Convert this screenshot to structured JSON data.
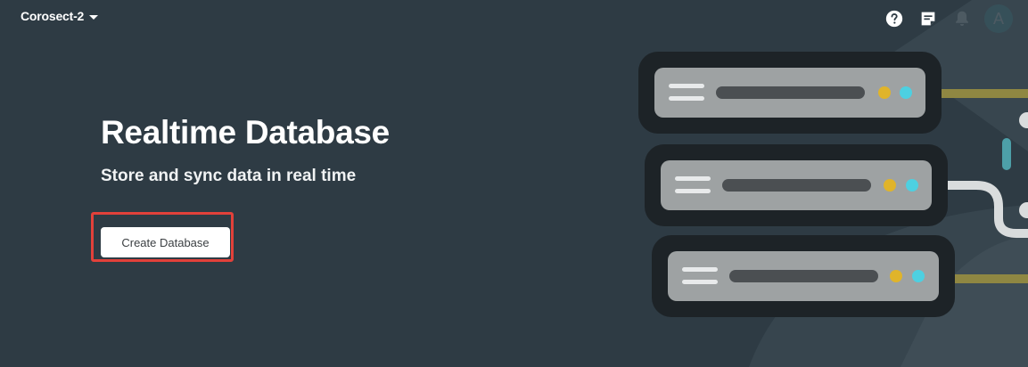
{
  "header": {
    "project_name": "Corosect-2",
    "avatar_initial": "A"
  },
  "icons": {
    "dropdown": "chevron-down-icon",
    "help": "help-icon",
    "notes": "release-notes-icon",
    "notifications": "bell-icon"
  },
  "hero": {
    "title": "Realtime Database",
    "subtitle": "Store and sync data in real time",
    "cta_label": "Create Database"
  },
  "colors": {
    "background": "#2e3b44",
    "avatar": "#1a9aa6",
    "highlight": "#e2413a",
    "status_yellow": "#e0b42a",
    "status_cyan": "#4dd0e1"
  }
}
